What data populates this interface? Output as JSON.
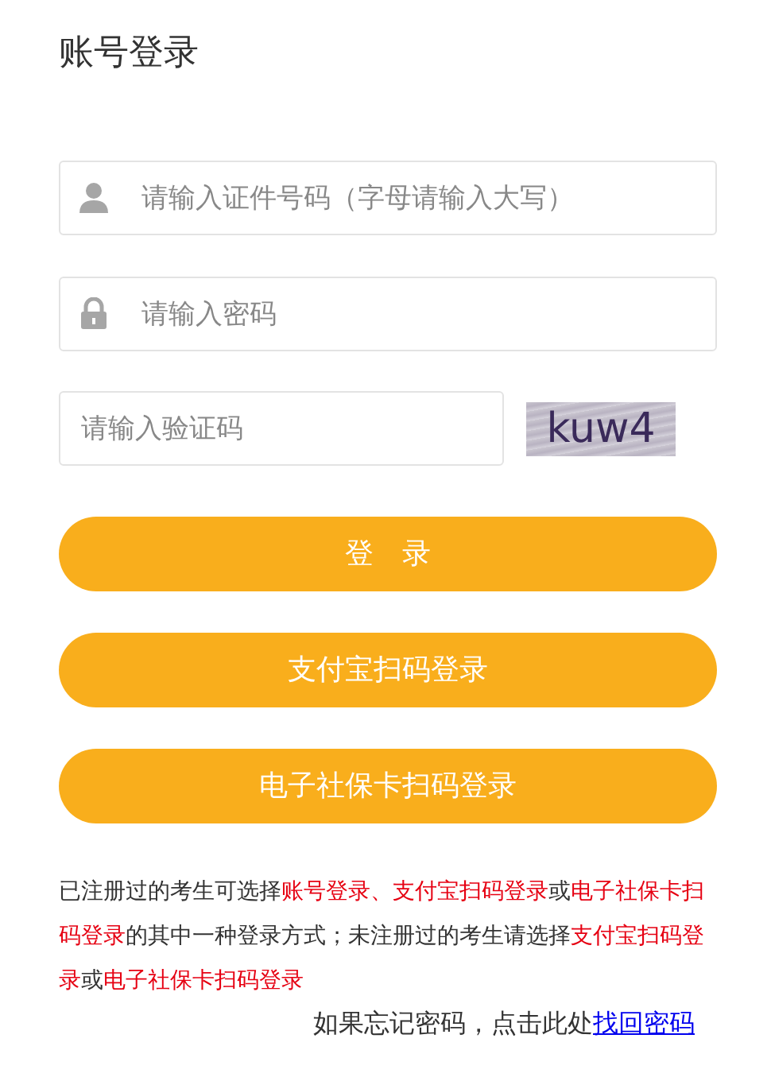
{
  "title": "账号登录",
  "fields": [
    {
      "kind": "id",
      "placeholder": "请输入证件号码（字母请输入大写）"
    },
    {
      "kind": "password",
      "placeholder": "请输入密码"
    }
  ],
  "captcha": {
    "placeholder": "请输入验证码",
    "image_text": "kuw4"
  },
  "buttons": [
    "登　录",
    "支付宝扫码登录",
    "电子社保卡扫码登录"
  ],
  "note": [
    {
      "text": "已注册过的考生可选择",
      "highlight": false
    },
    {
      "text": "账号登录、支付宝扫码登录",
      "highlight": true
    },
    {
      "text": "或",
      "highlight": false
    },
    {
      "text": "电子社保卡扫码登录",
      "highlight": true
    },
    {
      "text": "的其中一种登录方式；未注册过的考生请选择",
      "highlight": false
    },
    {
      "text": "支付宝扫码登录",
      "highlight": true
    },
    {
      "text": "或",
      "highlight": false
    },
    {
      "text": "电子社保卡扫码登录",
      "highlight": true
    }
  ],
  "forgot": {
    "text": "如果忘记密码，点击此处",
    "link": "找回密码"
  }
}
